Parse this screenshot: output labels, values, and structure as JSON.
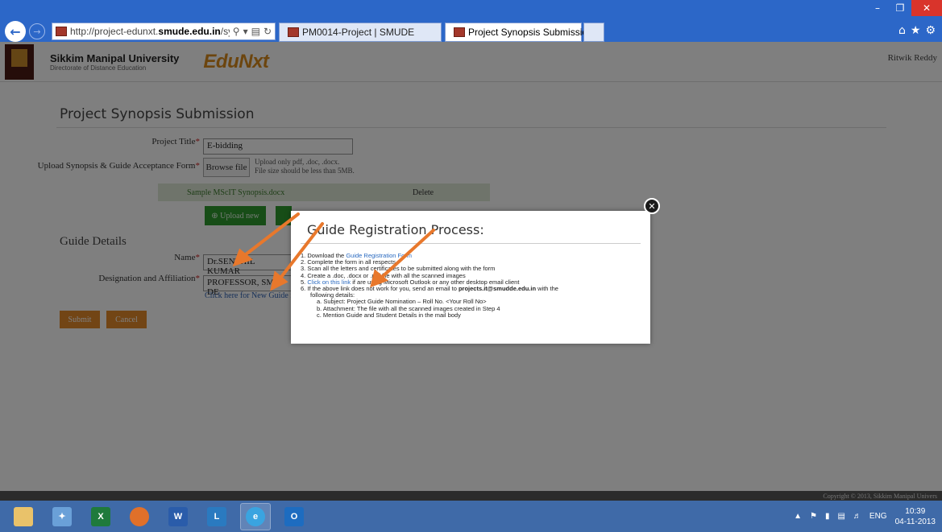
{
  "browser": {
    "url_prefix": "http://project-edunxt.",
    "url_domain": "smude.edu.in",
    "url_suffix": "/synopsisForm.",
    "tabs": [
      {
        "label": "PM0014-Project | SMUDE"
      },
      {
        "label": "Project Synopsis Submission"
      }
    ]
  },
  "header": {
    "university": "Sikkim Manipal University",
    "subtitle": "Directorate of Distance Education",
    "product": "EduNxt",
    "user": "Ritwik Reddy"
  },
  "form": {
    "title": "Project Synopsis Submission",
    "project_title_label": "Project Title",
    "project_title_value": "E-bidding",
    "upload_label": "Upload Synopsis & Guide Acceptance Form",
    "browse_label": "Browse file",
    "upload_hint_1": "Upload only pdf, .doc, .docx.",
    "upload_hint_2": "File size should be less than 5MB.",
    "file_name": "Sample MScIT Synopsis.docx",
    "delete_label": "Delete",
    "upload_new_label": "⊕ Upload new"
  },
  "guide": {
    "title": "Guide Details",
    "name_label": "Name",
    "name_value": "Dr.SENTHIL KUMAR",
    "designation_label": "Designation and Affiliation",
    "designation_value": "PROFESSOR, SMU-DE",
    "new_guide_link": "Click here for New Guide reg",
    "submit_label": "Submit",
    "cancel_label": "Cancel"
  },
  "modal": {
    "title": "Guide Registration Process:",
    "steps": [
      {
        "num": "1.",
        "pre": "Download the ",
        "link": "Guide Registration Form",
        "post": ""
      },
      {
        "num": "2.",
        "pre": "Complete the form in all respects",
        "link": "",
        "post": ""
      },
      {
        "num": "3.",
        "pre": "Scan all the letters and certificates to be submitted along with the form",
        "link": "",
        "post": ""
      },
      {
        "num": "4.",
        "pre": "Create a .doc, .docx or .pdf file with all the scanned images",
        "link": "",
        "post": ""
      },
      {
        "num": "5.",
        "pre": "",
        "link": "Click on this link",
        "post": " if are using Microsoft Outlook or any other desktop email client"
      },
      {
        "num": "6.",
        "pre": "If the above link does not work for you, send an email to ",
        "link": "",
        "post": " with the"
      }
    ],
    "email": "projects.it@smudde.edu.in",
    "step6_cont": "following details:",
    "sub_steps": [
      "a.  Subject: Project Guide Nomination – Roll No. <Your Roll No>",
      "b.  Attachment: The file with all the scanned images created in Step 4",
      "c.  Mention Guide and Student Details in the mail body"
    ]
  },
  "footer": {
    "copyright": "Copyright © 2013, Sikkim Manipal Univers"
  },
  "taskbar": {
    "lang": "ENG",
    "time": "10:39",
    "date": "04-11-2013"
  }
}
